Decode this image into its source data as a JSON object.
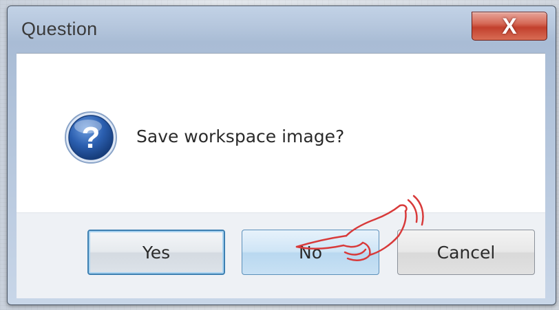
{
  "window": {
    "title": "Question",
    "close_label": "X"
  },
  "dialog": {
    "icon": "question-icon",
    "icon_glyph": "?",
    "message": "Save workspace image?"
  },
  "buttons": {
    "yes_label": "Yes",
    "no_label": "No",
    "cancel_label": "Cancel"
  },
  "annotation": {
    "icon": "pointing-hand-icon",
    "target": "No",
    "color": "#d83a3a"
  },
  "colors": {
    "accent": "#3c7fb1",
    "close_button": "#c2402d",
    "icon_blue": "#1f4f96"
  }
}
